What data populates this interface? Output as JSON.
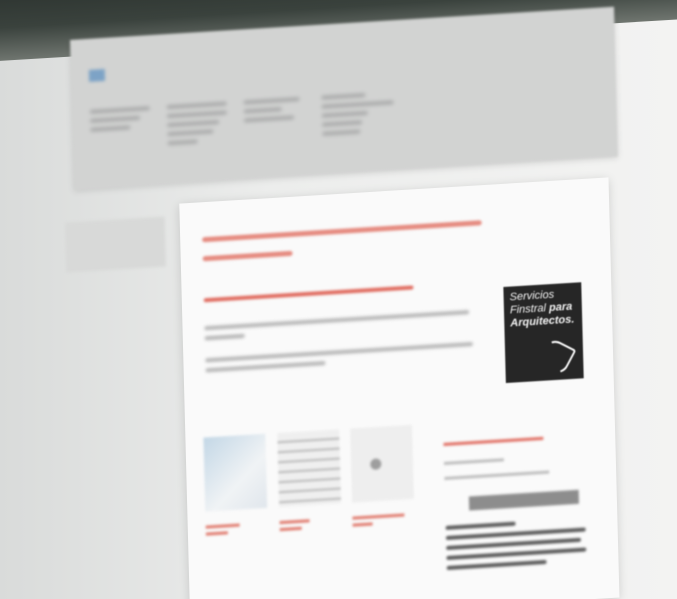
{
  "badge": {
    "line1": "Servicios",
    "line2": "Finstral",
    "line2_bold": "para",
    "line3": "Arquitectos."
  }
}
